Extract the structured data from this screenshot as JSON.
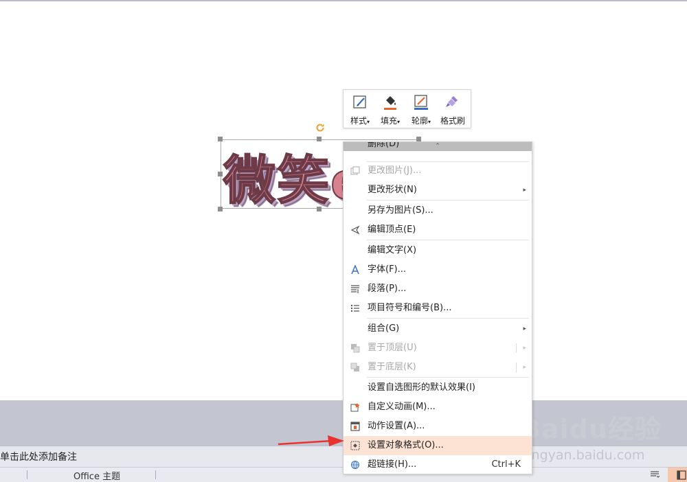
{
  "mini_toolbar": {
    "style_label": "样式",
    "fill_label": "填充",
    "outline_label": "轮廓",
    "painter_label": "格式刷",
    "dropdown_glyph": "▾"
  },
  "wordart": {
    "text": "微笑e"
  },
  "context_menu": {
    "scroll_up_glyph": "⌃",
    "items": [
      {
        "label": "删除(D)",
        "disabled": false
      },
      {
        "label": "更改图片(J)...",
        "disabled": true
      },
      {
        "label": "更改形状(N)",
        "submenu": true
      },
      {
        "label": "另存为图片(S)..."
      },
      {
        "label": "编辑顶点(E)"
      },
      {
        "label": "编辑文字(X)"
      },
      {
        "label": "字体(F)..."
      },
      {
        "label": "段落(P)..."
      },
      {
        "label": "项目符号和编号(B)..."
      },
      {
        "label": "组合(G)",
        "submenu": true
      },
      {
        "label": "置于顶层(U)",
        "disabled": true,
        "submenu": true
      },
      {
        "label": "置于底层(K)",
        "disabled": true,
        "submenu": true
      },
      {
        "label": "设置自选图形的默认效果(I)"
      },
      {
        "label": "自定义动画(M)..."
      },
      {
        "label": "动作设置(A)..."
      },
      {
        "label": "设置对象格式(O)...",
        "highlighted": true
      },
      {
        "label": "超链接(H)...",
        "shortcut": "Ctrl+K"
      }
    ],
    "submenu_glyph": "▸"
  },
  "notes": {
    "placeholder": "单击此处添加备注"
  },
  "status_bar": {
    "theme": "Office 主题"
  },
  "watermark": {
    "logo": "Baidu经验",
    "url": "jingyan.baidu.com"
  },
  "colors": {
    "highlight": "#fde3d4",
    "arrow": "#e8322e",
    "accent_fill": "#e8642c"
  }
}
